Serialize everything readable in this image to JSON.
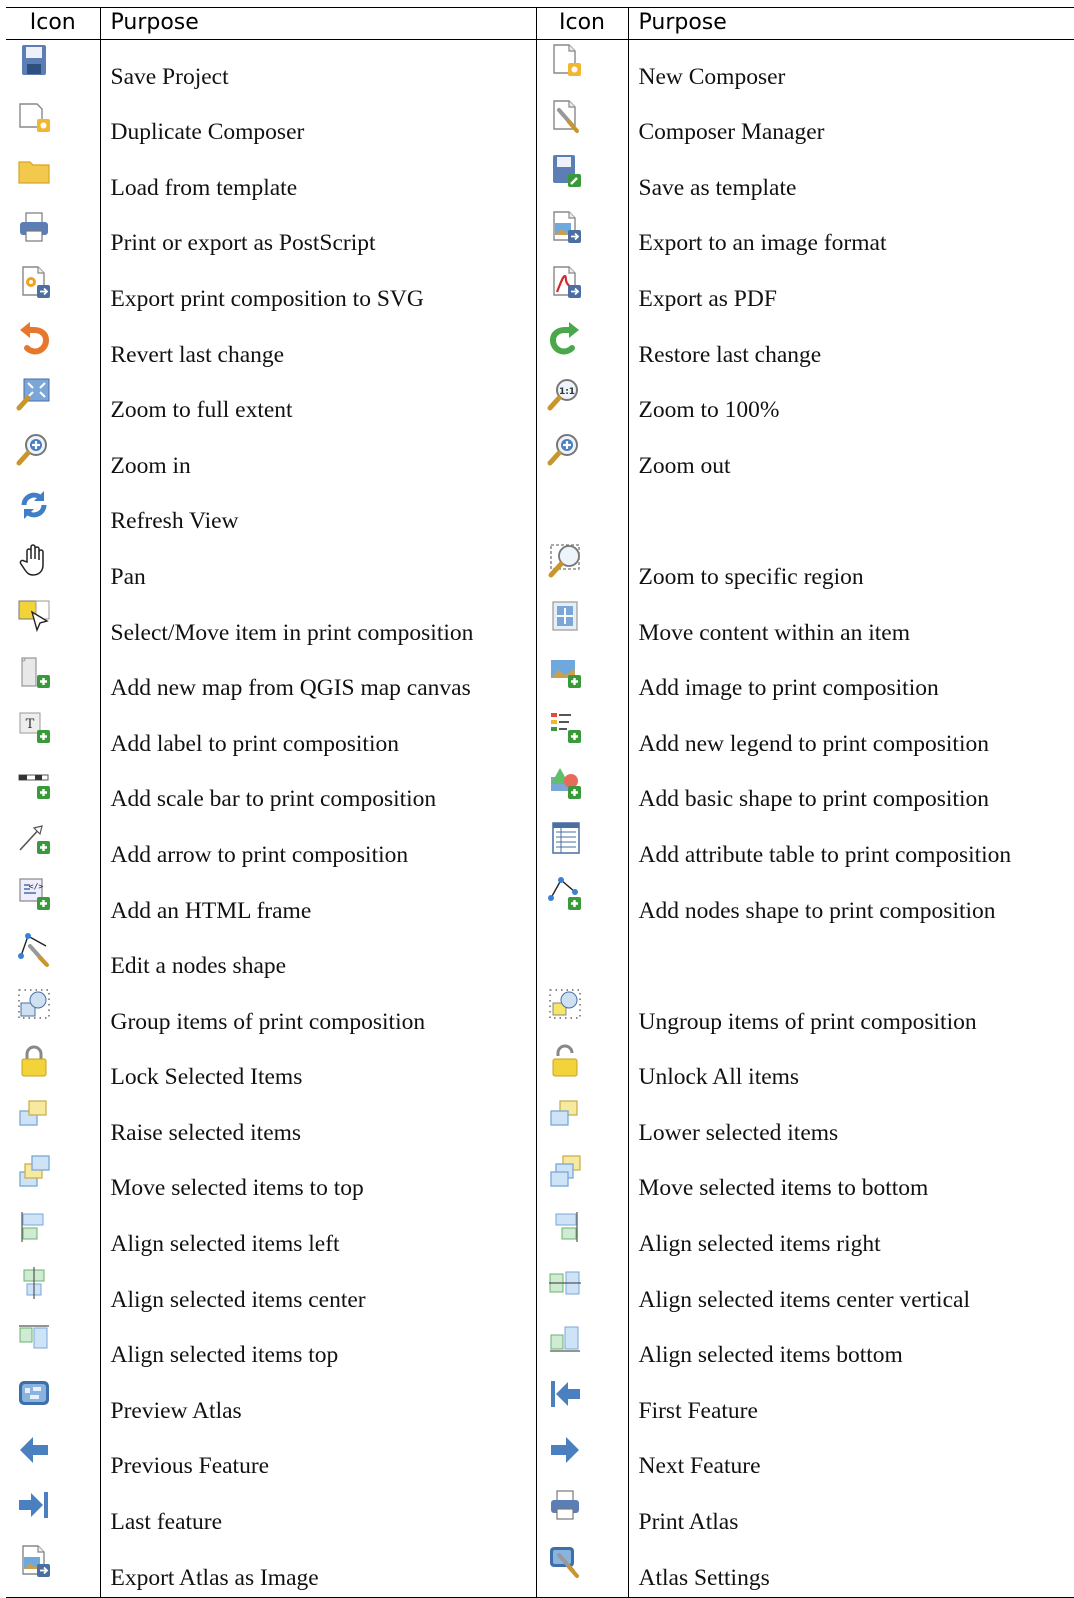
{
  "table": {
    "headers": [
      "Icon",
      "Purpose",
      "Icon",
      "Purpose"
    ],
    "rows": [
      [
        {
          "icon": "save-project-icon",
          "label": "Save Project"
        },
        {
          "icon": "new-composer-icon",
          "label": "New Composer"
        }
      ],
      [
        {
          "icon": "duplicate-composer-icon",
          "label": "Duplicate Composer"
        },
        {
          "icon": "composer-manager-icon",
          "label": "Composer Manager"
        }
      ],
      [
        {
          "icon": "folder-icon",
          "label": "Load from template"
        },
        {
          "icon": "save-template-icon",
          "label": "Save as template"
        }
      ],
      [
        {
          "icon": "printer-icon",
          "label": "Print or export as PostScript"
        },
        {
          "icon": "export-image-icon",
          "label": "Export to an image format"
        }
      ],
      [
        {
          "icon": "export-svg-icon",
          "label": "Export print composition to SVG"
        },
        {
          "icon": "export-pdf-icon",
          "label": "Export as PDF"
        }
      ],
      [
        {
          "icon": "undo-icon",
          "label": "Revert last change"
        },
        {
          "icon": "redo-icon",
          "label": "Restore last change"
        }
      ],
      [
        {
          "icon": "zoom-full-icon",
          "label": "Zoom to full extent"
        },
        {
          "icon": "zoom-actual-icon",
          "label": "Zoom to 100%"
        }
      ],
      [
        {
          "icon": "zoom-in-icon",
          "label": "Zoom in"
        },
        {
          "icon": "zoom-out-icon",
          "label": "Zoom out"
        }
      ],
      [
        {
          "icon": "refresh-icon",
          "label": "Refresh View"
        },
        null
      ],
      [
        {
          "icon": "pan-hand-icon",
          "label": "Pan"
        },
        {
          "icon": "zoom-region-icon",
          "label": "Zoom to specific region"
        }
      ],
      [
        {
          "icon": "select-move-icon",
          "label": "Select/Move item in print composition"
        },
        {
          "icon": "move-content-icon",
          "label": "Move content within an item"
        }
      ],
      [
        {
          "icon": "add-map-icon",
          "label": "Add new map from QGIS map canvas"
        },
        {
          "icon": "add-image-icon",
          "label": "Add image to print composition"
        }
      ],
      [
        {
          "icon": "add-label-icon",
          "label": "Add label to print composition"
        },
        {
          "icon": "add-legend-icon",
          "label": "Add new legend to print composition"
        }
      ],
      [
        {
          "icon": "add-scalebar-icon",
          "label": "Add scale bar to print composition"
        },
        {
          "icon": "add-shape-icon",
          "label": "Add basic shape to print composition"
        }
      ],
      [
        {
          "icon": "add-arrow-icon",
          "label": "Add arrow to print composition"
        },
        {
          "icon": "add-table-icon",
          "label": "Add attribute table to print composition"
        }
      ],
      [
        {
          "icon": "add-html-icon",
          "label": "Add an HTML frame"
        },
        {
          "icon": "add-nodes-icon",
          "label": "Add nodes shape to print composition"
        }
      ],
      [
        {
          "icon": "edit-nodes-icon",
          "label": "Edit a nodes shape"
        },
        null
      ],
      [
        {
          "icon": "group-items-icon",
          "label": "Group items of print composition"
        },
        {
          "icon": "ungroup-items-icon",
          "label": "Ungroup items of print composition"
        }
      ],
      [
        {
          "icon": "lock-icon",
          "label": "Lock Selected Items"
        },
        {
          "icon": "unlock-icon",
          "label": "Unlock All items"
        }
      ],
      [
        {
          "icon": "raise-items-icon",
          "label": "Raise selected items"
        },
        {
          "icon": "lower-items-icon",
          "label": "Lower selected items"
        }
      ],
      [
        {
          "icon": "move-top-icon",
          "label": "Move selected items to top"
        },
        {
          "icon": "move-bottom-icon",
          "label": "Move selected items to bottom"
        }
      ],
      [
        {
          "icon": "align-left-icon",
          "label": "Align selected items left"
        },
        {
          "icon": "align-right-icon",
          "label": "Align selected items right"
        }
      ],
      [
        {
          "icon": "align-hcenter-icon",
          "label": "Align selected items center"
        },
        {
          "icon": "align-vcenter-icon",
          "label": "Align selected items center vertical"
        }
      ],
      [
        {
          "icon": "align-top-icon",
          "label": "Align selected items top"
        },
        {
          "icon": "align-bottom-icon",
          "label": "Align selected items bottom"
        }
      ],
      [
        {
          "icon": "preview-atlas-icon",
          "label": "Preview Atlas"
        },
        {
          "icon": "first-feature-icon",
          "label": "First Feature"
        }
      ],
      [
        {
          "icon": "previous-feature-icon",
          "label": "Previous Feature"
        },
        {
          "icon": "next-feature-icon",
          "label": "Next Feature"
        }
      ],
      [
        {
          "icon": "last-feature-icon",
          "label": "Last feature"
        },
        {
          "icon": "print-atlas-icon",
          "label": "Print Atlas"
        }
      ],
      [
        {
          "icon": "export-atlas-image-icon",
          "label": "Export Atlas as Image"
        },
        {
          "icon": "atlas-settings-icon",
          "label": "Atlas Settings"
        }
      ]
    ]
  }
}
